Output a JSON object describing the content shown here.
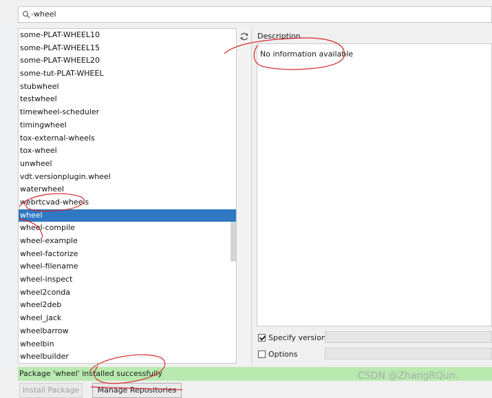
{
  "search": {
    "value": "-wheel"
  },
  "packages": [
    "some-PLAT-WHEEL10",
    "some-PLAT-WHEEL15",
    "some-PLAT-WHEEL20",
    "some-tut-PLAT-WHEEL",
    "stubwheel",
    "testwheel",
    "timewheel-scheduler",
    "timingwheel",
    "tox-external-wheels",
    "tox-wheel",
    "unwheel",
    "vdt.versionplugin.wheel",
    "waterwheel",
    "webrtcvad-wheels",
    "wheel",
    "wheel-compile",
    "wheel-example",
    "wheel-factorize",
    "wheel-filename",
    "wheel-inspect",
    "wheel2conda",
    "wheel2deb",
    "wheel_jack",
    "wheelbarrow",
    "wheelbin",
    "wheelbuilder"
  ],
  "selected_package": "wheel",
  "description": {
    "label": "Description",
    "text": "No information available"
  },
  "options": {
    "specify_version_label": "Specify version",
    "specify_version_checked": true,
    "options_label": "Options",
    "options_checked": false
  },
  "status": {
    "message": "Package 'wheel' installed successfully",
    "color": "#b8eab0"
  },
  "buttons": {
    "install": "Install Package",
    "manage": "Manage Repositories"
  },
  "watermark": "CSDN @ZhangRQun."
}
